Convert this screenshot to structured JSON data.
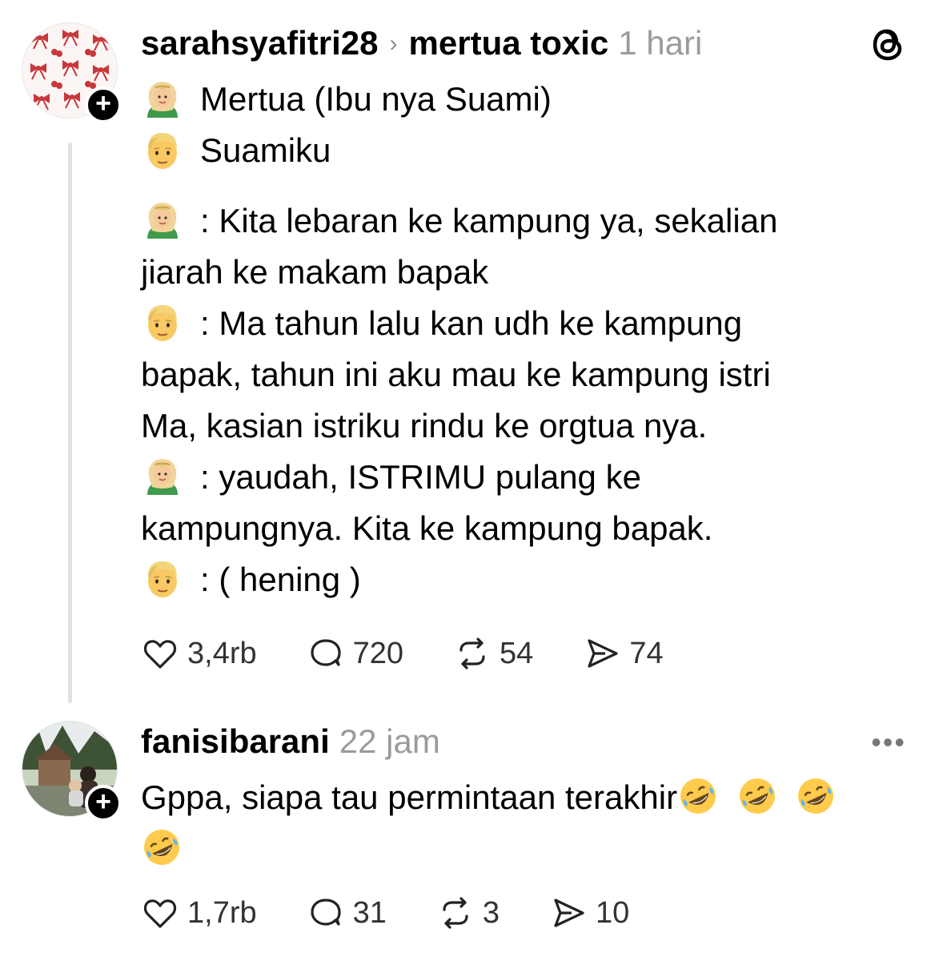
{
  "post1": {
    "username": "sarahsyafitri28",
    "chevron": "›",
    "topic": "mertua toxic",
    "time": "1 hari",
    "avatar": "bows-cherries-avatar",
    "logo_icon": "threads-logo-icon",
    "lines": {
      "l1": "Mertua (Ibu nya Suami)",
      "l2": "Suamiku",
      "l3a": ": Kita lebaran ke kampung ya, sekalian",
      "l3b": "jiarah ke makam bapak",
      "l4a": ": Ma tahun lalu kan udh ke kampung",
      "l4b": "bapak, tahun ini aku mau ke kampung istri",
      "l4c": "Ma, kasian istriku rindu ke orgtua nya.",
      "l5a": ": yaudah, ISTRIMU pulang ke",
      "l5b": "kampungnya. Kita ke kampung bapak.",
      "l6": ": ( hening )"
    },
    "stats": {
      "likes": "3,4rb",
      "comments": "720",
      "reposts": "54",
      "shares": "74"
    }
  },
  "post2": {
    "username": "fanisibarani",
    "time": "22 jam",
    "more_label": "•••",
    "text": "Gppa, siapa tau permintaan terakhir",
    "stats": {
      "likes": "1,7rb",
      "comments": "31",
      "reposts": "3",
      "shares": "10"
    }
  },
  "colors": {
    "text": "#000000",
    "muted": "#9b9b9b",
    "thread_line": "#e0e0e0",
    "badge": "#000000"
  }
}
